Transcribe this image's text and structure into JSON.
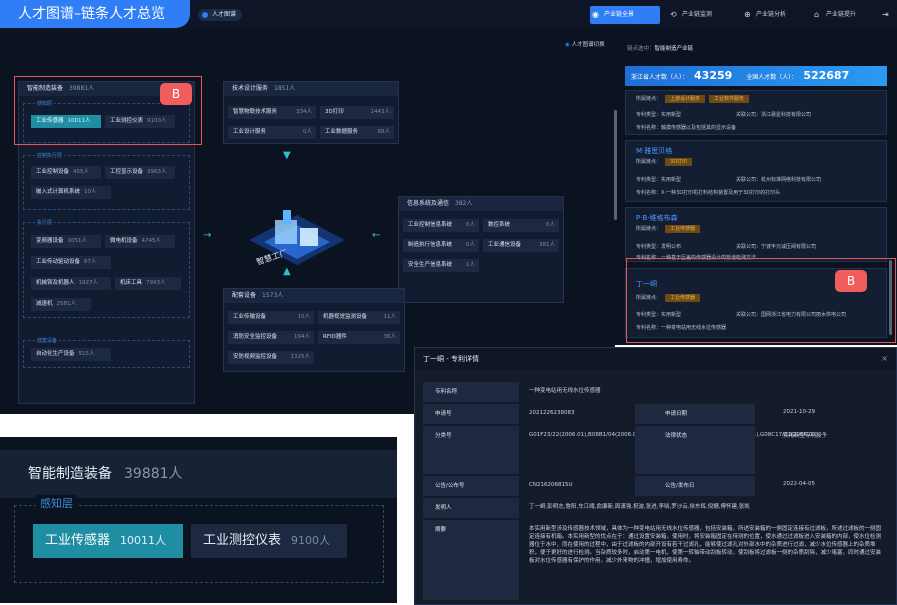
{
  "banner": {
    "title": "人才图谱–链条人才总览"
  },
  "topbar": {
    "pill": "人才图谱",
    "nav": [
      {
        "icon": "◉",
        "label": "产业链全景"
      },
      {
        "icon": "⟲",
        "label": "产业链监测"
      },
      {
        "icon": "⊕",
        "label": "产业链分析"
      },
      {
        "icon": "⌂",
        "label": "产业链提升"
      },
      {
        "icon": "⇥",
        "label": ""
      }
    ]
  },
  "main": {
    "switch": "人才图谱切换",
    "left_box": {
      "title": "智能制造装备",
      "count": "39881人",
      "groups": [
        {
          "label": "感知层",
          "items": [
            {
              "name": "工业传感器",
              "n": "10011人"
            },
            {
              "name": "工业测控仪表",
              "n": "9100人"
            }
          ]
        },
        {
          "label": "控制执行层",
          "items": [
            {
              "name": "工业控制设备",
              "n": "455人"
            },
            {
              "name": "工控显示设备",
              "n": "3963人"
            },
            {
              "name": "嵌入式计算机系统",
              "n": "10人"
            }
          ]
        },
        {
          "label": "执行层",
          "items": [
            {
              "name": "变频器设备",
              "n": "1051人"
            },
            {
              "name": "微电机设备",
              "n": "4745人"
            },
            {
              "name": "工业传动驱动设备",
              "n": "87人"
            },
            {
              "name": "机械臂及机器人",
              "n": "1927人"
            },
            {
              "name": "机床工具",
              "n": "7993人"
            },
            {
              "name": "减速机",
              "n": "2581人"
            }
          ]
        },
        {
          "label": "成套设备",
          "items": [
            {
              "name": "自动化生产设备",
              "n": "515人"
            }
          ]
        }
      ]
    },
    "tech_box": {
      "title": "技术设计服务",
      "count": "1851人",
      "items": [
        {
          "name": "智慧物联技术服务",
          "n": "334人"
        },
        {
          "name": "3D打印",
          "n": "1443人"
        },
        {
          "name": "工业设计服务",
          "n": "0人"
        },
        {
          "name": "工业数据服务",
          "n": "88人"
        }
      ]
    },
    "info_box": {
      "title": "信息系统及通信",
      "count": "382人",
      "items": [
        {
          "name": "工业控制信息系统",
          "n": "0人"
        },
        {
          "name": "数控系统",
          "n": "0人"
        },
        {
          "name": "制造执行信息系统",
          "n": "0人"
        },
        {
          "name": "工业通信设备",
          "n": "381人"
        },
        {
          "name": "安全生产信息系统",
          "n": "1人"
        }
      ]
    },
    "parts_box": {
      "title": "配套设备",
      "count": "1573人",
      "items": [
        {
          "name": "工业传输设备",
          "n": "10人"
        },
        {
          "name": "机器视觉监测设备",
          "n": "11人"
        },
        {
          "name": "消防安全监控设备",
          "n": "194人"
        },
        {
          "name": "RFID器件",
          "n": "36人"
        },
        {
          "name": "安防视频监控设备",
          "n": "1325人"
        }
      ]
    },
    "center_label": "智慧工厂",
    "badge": "B"
  },
  "right": {
    "node": "链点选中：",
    "node_val": "智能制造产业链",
    "stat1_label": "浙江省人才数（人）：",
    "stat1": "43259",
    "stat2_label": "全国人才数（人）：",
    "stat2": "522687",
    "cards": [
      {
        "title": "",
        "tags": [
          "上游设计服务",
          "工业软件服务"
        ],
        "type": "实用新型",
        "org": "浙江晨星科技有限公司",
        "patent": "触摸传感器以及包括其的显示设备"
      },
      {
        "title": "M·雅思贝格",
        "tags": [
          "3D打印"
        ],
        "type": "实用新型",
        "org": "杭州标准网络科技有限公司",
        "patent": "X·一种3D打印机打料结构装置及用于3D打印的打印头"
      },
      {
        "title": "P·B·维格布森",
        "tags": [
          "工业传感器"
        ],
        "type": "发明公布",
        "org": "宁波丰元减压阀有限公司",
        "patent": "一种基于压差的传感器设计的管道检测方法"
      },
      {
        "title": "丁一峒",
        "tags": [
          "工业传感器"
        ],
        "type": "实用新型",
        "org": "国网浙江省电力有限公司丽水供电公司",
        "patent": "一种变电站用无线水位传感器"
      }
    ],
    "labels": {
      "node": "所属链点：",
      "type": "专利类型：",
      "org": "关联公司：",
      "patent": "专利名称："
    },
    "badge": "B"
  },
  "zoom": {
    "title": "智能制造装备",
    "count": "39881人",
    "layer": "感知层",
    "items": [
      {
        "name": "工业传感器",
        "n": "10011人"
      },
      {
        "name": "工业测控仪表",
        "n": "9100人"
      }
    ]
  },
  "modal": {
    "title": "丁一峒 - 专利详情",
    "close": "×",
    "k1": "专利名称",
    "v1": "一种变电站用无线水位传感器",
    "k2": "申请号",
    "v2": "2021226238083",
    "k2b": "申请日期",
    "v2b": "2021-10-29",
    "k3": "分类号",
    "v3": "G01F23/22(2006.01),B08B1/04(2006.01),H04N7/18(2006.01),H04N5/225(2006.01),G08C17/02(2006.01)",
    "k3b": "法律状态",
    "v3b": "实用新型专利授予",
    "k4": "公告/公布号",
    "v4": "CN216206815U",
    "k4b": "公告/发布日",
    "v4b": "2022-04-05",
    "k5": "发明人",
    "v5": "丁一峒,彭明志,詹阳,车江峨,俞廉新,周潇强,祝波,张进,李晓,罗沙云,徐东辉,倪姗,傅怀建,张凯",
    "k6": "摘要",
    "v6": "本实用新型涉及传感器技术领域，具体为一种变电站用无线水位传感器，包括安装箱，所述安装箱的一侧固定连接有过滤板，所述过滤板的一侧固定连接有机箱。本实用新型的优点在于：通过设置安装箱，使用时，将安装箱固定在待测的位置，使水通过过滤板进入安装箱的内部，使水位检测器位于水中，而在使用的过程中，由于过滤板的内部开设有若干过滤孔，能够使过滤孔对外部水中的杂质进行过滤，减少水位传感器上的杂质堆积，便于更好的进行检测。当杂质较多时，启动第一电机，使第一转轴带动刮板转动，使刮板将过滤板一侧的杂质刮除，减少堵塞，同时通过安装板对水位传感器有保护的作用，减少外来物的冲撞，增加使用寿命。"
  }
}
